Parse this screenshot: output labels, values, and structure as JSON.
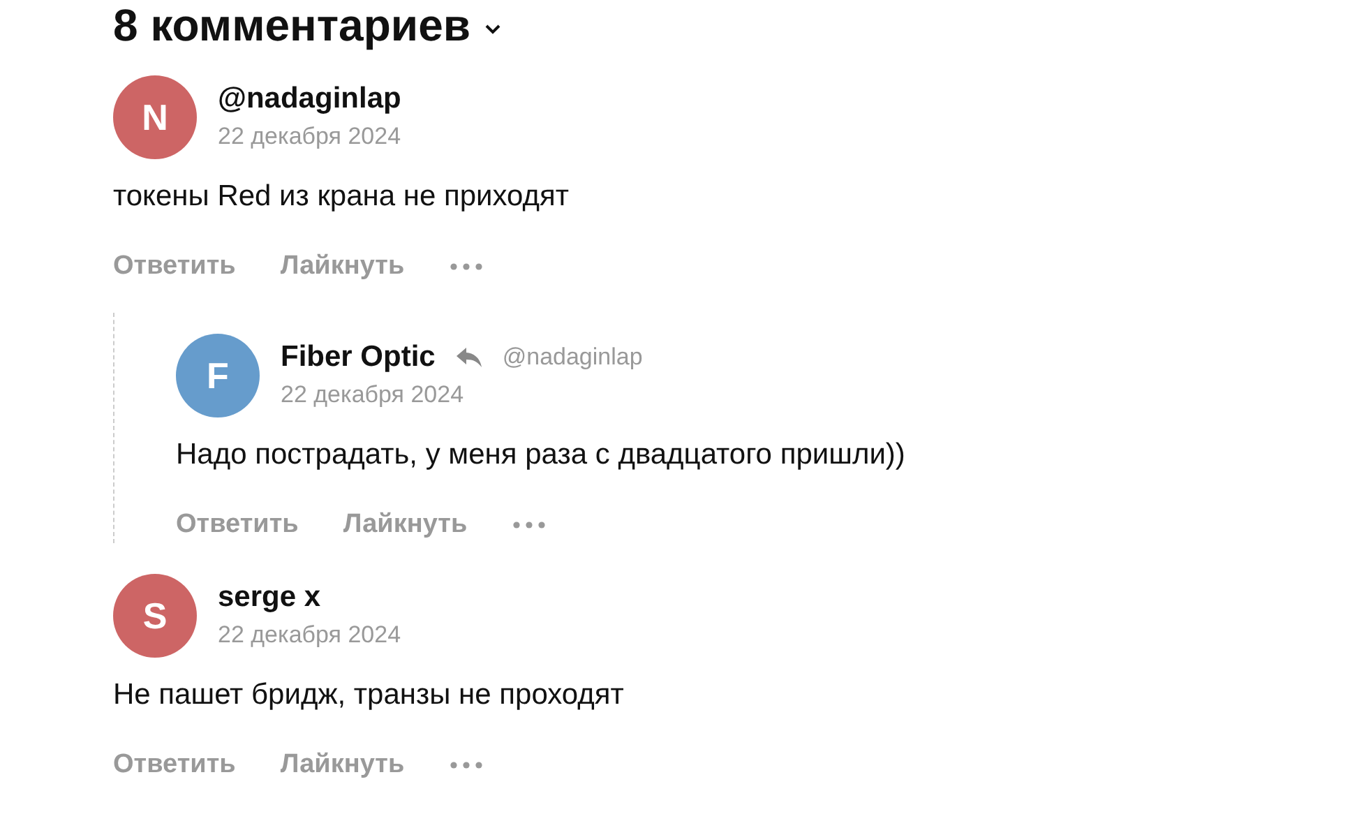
{
  "header": {
    "title": "8 комментариев"
  },
  "comments": [
    {
      "initial": "N",
      "color": "#cd6565",
      "author": "@nadaginlap",
      "date": "22 декабря 2024",
      "text": "токены Red из крана не приходят",
      "actions": [
        "Ответить",
        "Лайкнуть"
      ],
      "children": [
        {
          "initial": "F",
          "color": "#669ccc",
          "author": "Fiber Optic",
          "reply_to": "@nadaginlap",
          "date": "22 декабря 2024",
          "text": "Надо пострадать, у меня раза с двадцатого пришли))",
          "actions": [
            "Ответить",
            "Лайкнуть"
          ]
        }
      ]
    },
    {
      "initial": "S",
      "color": "#cd6565",
      "author": "serge x",
      "date": "22 декабря 2024",
      "text": "Не пашет бридж, транзы не проходят",
      "actions": [
        "Ответить",
        "Лайкнуть"
      ]
    }
  ]
}
